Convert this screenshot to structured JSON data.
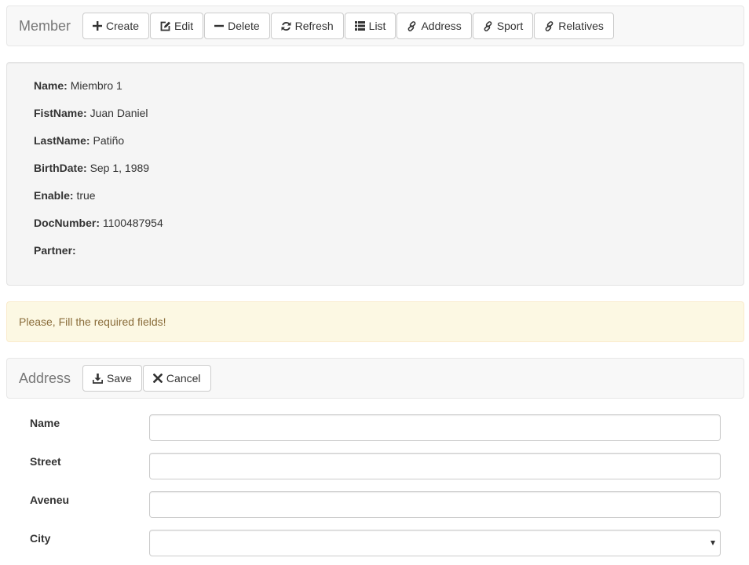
{
  "member_nav": {
    "brand": "Member",
    "buttons": [
      {
        "label": "Create",
        "icon": "plus-icon"
      },
      {
        "label": "Edit",
        "icon": "edit-icon"
      },
      {
        "label": "Delete",
        "icon": "minus-icon"
      },
      {
        "label": "Refresh",
        "icon": "refresh-icon"
      },
      {
        "label": "List",
        "icon": "list-icon"
      },
      {
        "label": "Address",
        "icon": "link-icon"
      },
      {
        "label": "Sport",
        "icon": "link-icon"
      },
      {
        "label": "Relatives",
        "icon": "link-icon"
      }
    ]
  },
  "details": [
    {
      "label": "Name:",
      "value": "Miembro 1"
    },
    {
      "label": "FistName:",
      "value": "Juan Daniel"
    },
    {
      "label": "LastName:",
      "value": "Patiño"
    },
    {
      "label": "BirthDate:",
      "value": "Sep 1, 1989"
    },
    {
      "label": "Enable:",
      "value": "true"
    },
    {
      "label": "DocNumber:",
      "value": "1100487954"
    },
    {
      "label": "Partner:",
      "value": ""
    }
  ],
  "alert": {
    "message": "Please, Fill the required fields!"
  },
  "address_nav": {
    "brand": "Address",
    "buttons": [
      {
        "label": "Save",
        "icon": "download-icon"
      },
      {
        "label": "Cancel",
        "icon": "close-icon"
      }
    ]
  },
  "address_form": {
    "fields": [
      {
        "label": "Name",
        "value": ""
      },
      {
        "label": "Street",
        "value": ""
      },
      {
        "label": "Aveneu",
        "value": ""
      },
      {
        "label": "City",
        "value": ""
      }
    ]
  },
  "colors": {
    "navbar_bg": "#f8f8f8",
    "well_bg": "#f5f5f5",
    "alert_bg": "#fcf8e3",
    "alert_text": "#8a6d3b"
  }
}
